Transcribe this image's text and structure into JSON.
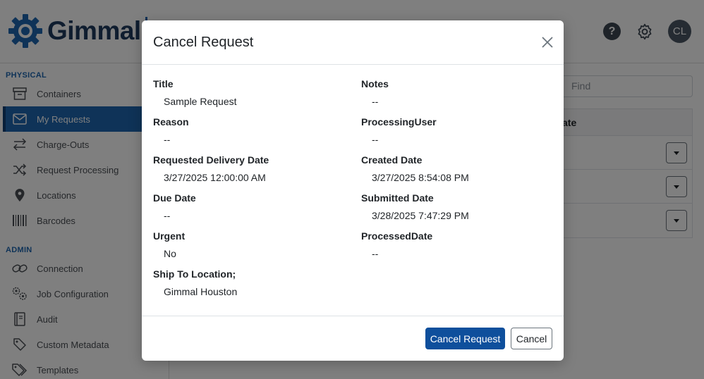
{
  "app": {
    "logo_text": "Gimmal",
    "help_label": "?",
    "avatar_initials": "CL",
    "find_placeholder": "Find",
    "table_header_partial": "ate"
  },
  "sidebar": {
    "sections": [
      {
        "title": "PHYSICAL"
      },
      {
        "title": "ADMIN"
      }
    ],
    "items": [
      {
        "label": "Containers",
        "icon": "archive-box-icon",
        "active": false
      },
      {
        "label": "My Requests",
        "icon": "envelope-icon",
        "active": true
      },
      {
        "label": "Charge-Outs",
        "icon": "swap-arrows-icon",
        "active": false
      },
      {
        "label": "Request Processing",
        "icon": "shuffle-icon",
        "active": false
      },
      {
        "label": "Locations",
        "icon": "map-pin-icon",
        "active": false
      },
      {
        "label": "Barcodes",
        "icon": "barcode-icon",
        "active": false
      },
      {
        "label": "Connection",
        "icon": "link-icon",
        "active": false
      },
      {
        "label": "Job Configuration",
        "icon": "gears-icon",
        "active": false
      },
      {
        "label": "Audit",
        "icon": "book-icon",
        "active": false
      },
      {
        "label": "Custom Metadata",
        "icon": "tag-icon",
        "active": false
      },
      {
        "label": "Templates",
        "icon": "tags-icon",
        "active": false
      }
    ]
  },
  "modal": {
    "title": "Cancel Request",
    "fields": [
      {
        "label": "Title",
        "value": "Sample Request"
      },
      {
        "label": "Notes",
        "value": "--"
      },
      {
        "label": "Reason",
        "value": "--"
      },
      {
        "label": "ProcessingUser",
        "value": "--"
      },
      {
        "label": "Requested Delivery Date",
        "value": "3/27/2025 12:00:00 AM"
      },
      {
        "label": "Created Date",
        "value": "3/27/2025 8:54:08 PM"
      },
      {
        "label": "Due Date",
        "value": "--"
      },
      {
        "label": "Submitted Date",
        "value": "3/28/2025 7:47:29 PM"
      },
      {
        "label": "Urgent",
        "value": "No"
      },
      {
        "label": "ProcessedDate",
        "value": "--"
      },
      {
        "label": "Ship To Location;",
        "value": "Gimmal Houston"
      }
    ],
    "confirm_label": "Cancel Request",
    "cancel_label": "Cancel"
  },
  "colors": {
    "brand_blue": "#1f67b1",
    "primary_button": "#0e4f9c",
    "logo_text": "#1f3a5f"
  }
}
